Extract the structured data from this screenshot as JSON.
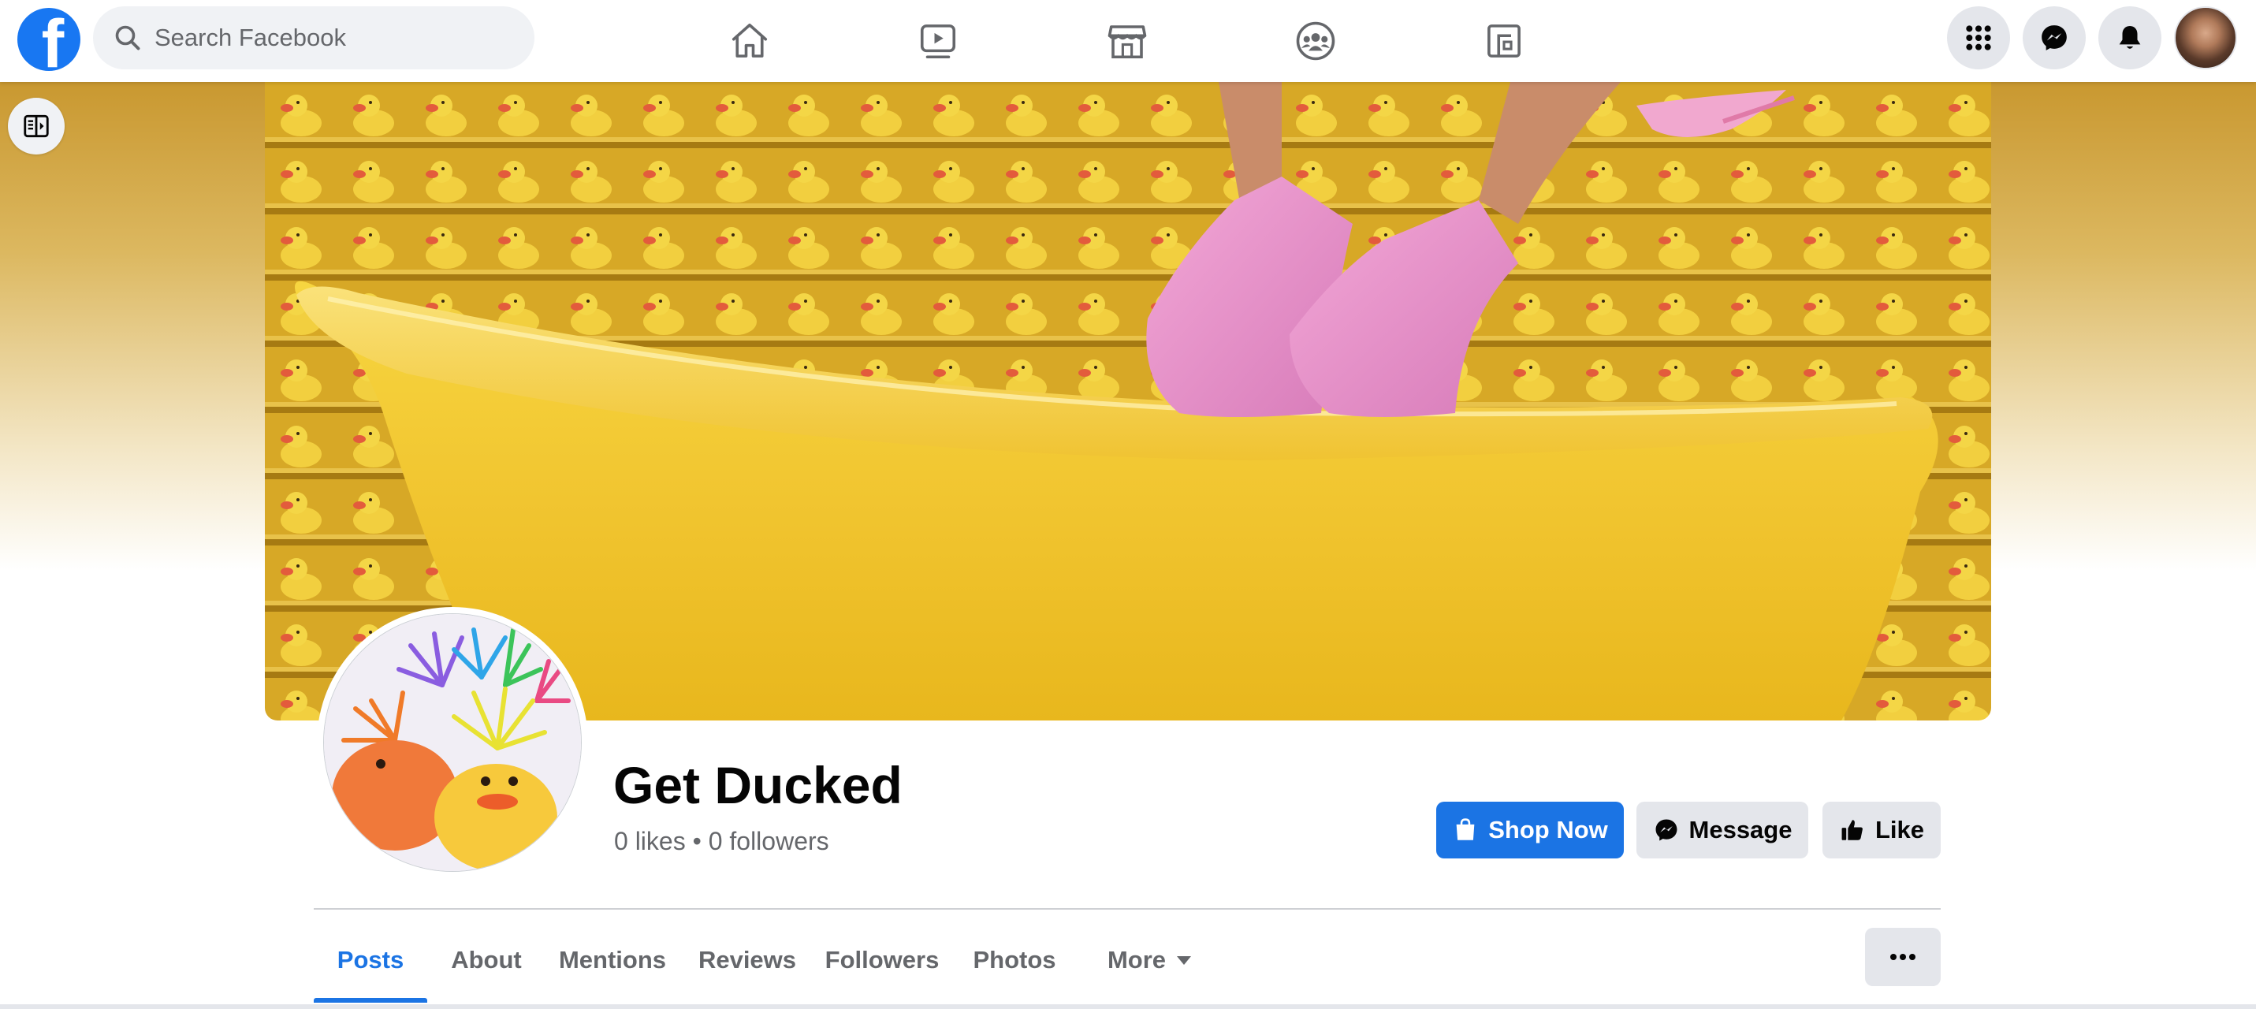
{
  "topbar": {
    "logo_letter": "f",
    "search": {
      "placeholder": "Search Facebook"
    },
    "nav_icons": [
      "home-icon",
      "watch-icon",
      "marketplace-icon",
      "groups-icon",
      "gaming-icon"
    ],
    "right_icons": [
      "menu-grid-icon",
      "messenger-icon",
      "notifications-bell-icon",
      "account-avatar"
    ]
  },
  "page": {
    "name": "Get Ducked",
    "stats": "0 likes • 0 followers",
    "actions": {
      "shop_now": "Shop Now",
      "message": "Message",
      "like": "Like"
    },
    "tabs": [
      {
        "label": "Posts",
        "active": true
      },
      {
        "label": "About"
      },
      {
        "label": "Mentions"
      },
      {
        "label": "Reviews"
      },
      {
        "label": "Followers"
      },
      {
        "label": "Photos"
      },
      {
        "label": "More"
      }
    ],
    "more_options_label": "..."
  },
  "colors": {
    "brand_blue": "#1877f2",
    "button_blue": "#1b74e4",
    "button_gray": "#e4e6eb",
    "secondary_text": "#65676b"
  }
}
